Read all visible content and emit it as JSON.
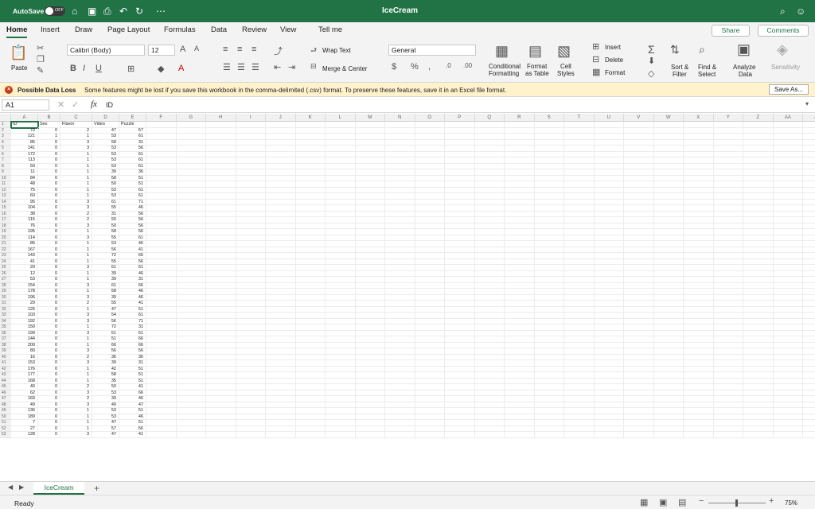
{
  "titlebar": {
    "autosave": "AutoSave",
    "autosave_state": "OFF",
    "doc_title": "IceCream",
    "accent": "#217346"
  },
  "tabs": [
    "Home",
    "Insert",
    "Draw",
    "Page Layout",
    "Formulas",
    "Data",
    "Review",
    "View",
    "Tell me"
  ],
  "share": "Share",
  "comments": "Comments",
  "ribbon": {
    "paste": "Paste",
    "font": "Calibri (Body)",
    "size": "12",
    "wrap": "Wrap Text",
    "merge": "Merge & Center",
    "numfmt": "General",
    "cond_format": [
      "Conditional",
      "Formatting"
    ],
    "format_table": [
      "Format",
      "as Table"
    ],
    "cell_styles": [
      "Cell",
      "Styles"
    ],
    "insert": "Insert",
    "delete": "Delete",
    "format": "Format",
    "sort": [
      "Sort &",
      "Filter"
    ],
    "find": [
      "Find &",
      "Select"
    ],
    "analyze": [
      "Analyze",
      "Data"
    ],
    "sensitivity": "Sensitivity"
  },
  "infobar": {
    "title": "Possible Data Loss",
    "message": "Some features might be lost if you save this workbook in the comma-delimited (.csv) format. To preserve these features, save it in an Excel file format.",
    "button": "Save As..."
  },
  "formula": {
    "name_box": "A1",
    "value": "ID"
  },
  "columns": [
    "A",
    "B",
    "C",
    "D",
    "E",
    "F",
    "G",
    "H",
    "I",
    "J",
    "K",
    "L",
    "M",
    "N",
    "O",
    "P",
    "Q",
    "R",
    "S",
    "T",
    "U",
    "V",
    "W",
    "X",
    "Y",
    "Z",
    "AA",
    "AB",
    "AC"
  ],
  "headers": [
    "ID",
    "Sex",
    "Flavor",
    "Video",
    "Puzzle"
  ],
  "rows": [
    [
      "70",
      "0",
      "2",
      "47",
      "57"
    ],
    [
      "121",
      "1",
      "1",
      "53",
      "61"
    ],
    [
      "86",
      "0",
      "3",
      "58",
      "31"
    ],
    [
      "141",
      "0",
      "3",
      "53",
      "56"
    ],
    [
      "172",
      "0",
      "1",
      "53",
      "61"
    ],
    [
      "113",
      "0",
      "1",
      "53",
      "61"
    ],
    [
      "50",
      "0",
      "1",
      "53",
      "61"
    ],
    [
      "11",
      "0",
      "1",
      "39",
      "36"
    ],
    [
      "84",
      "0",
      "1",
      "58",
      "51"
    ],
    [
      "48",
      "0",
      "1",
      "50",
      "51"
    ],
    [
      "75",
      "0",
      "1",
      "53",
      "61"
    ],
    [
      "60",
      "0",
      "1",
      "53",
      "61"
    ],
    [
      "95",
      "0",
      "3",
      "61",
      "71"
    ],
    [
      "104",
      "0",
      "3",
      "55",
      "46"
    ],
    [
      "38",
      "0",
      "2",
      "31",
      "56"
    ],
    [
      "115",
      "0",
      "2",
      "50",
      "56"
    ],
    [
      "76",
      "0",
      "3",
      "50",
      "56"
    ],
    [
      "195",
      "0",
      "1",
      "58",
      "56"
    ],
    [
      "114",
      "0",
      "3",
      "55",
      "61"
    ],
    [
      "85",
      "0",
      "1",
      "53",
      "46"
    ],
    [
      "167",
      "0",
      "1",
      "56",
      "41"
    ],
    [
      "143",
      "0",
      "1",
      "72",
      "66"
    ],
    [
      "41",
      "0",
      "1",
      "55",
      "56"
    ],
    [
      "20",
      "0",
      "3",
      "61",
      "61"
    ],
    [
      "12",
      "0",
      "1",
      "39",
      "46"
    ],
    [
      "53",
      "0",
      "1",
      "39",
      "31"
    ],
    [
      "154",
      "0",
      "3",
      "61",
      "66"
    ],
    [
      "178",
      "0",
      "1",
      "58",
      "46"
    ],
    [
      "196",
      "0",
      "3",
      "39",
      "46"
    ],
    [
      "29",
      "0",
      "2",
      "55",
      "41"
    ],
    [
      "126",
      "0",
      "1",
      "47",
      "51"
    ],
    [
      "103",
      "0",
      "3",
      "54",
      "61"
    ],
    [
      "192",
      "0",
      "3",
      "56",
      "71"
    ],
    [
      "150",
      "0",
      "1",
      "72",
      "31"
    ],
    [
      "199",
      "0",
      "3",
      "61",
      "61"
    ],
    [
      "144",
      "0",
      "1",
      "51",
      "66"
    ],
    [
      "200",
      "0",
      "1",
      "66",
      "66"
    ],
    [
      "80",
      "0",
      "3",
      "56",
      "56"
    ],
    [
      "16",
      "0",
      "2",
      "36",
      "36"
    ],
    [
      "153",
      "0",
      "3",
      "39",
      "31"
    ],
    [
      "176",
      "0",
      "1",
      "42",
      "51"
    ],
    [
      "177",
      "0",
      "1",
      "58",
      "51"
    ],
    [
      "168",
      "0",
      "1",
      "35",
      "51"
    ],
    [
      "40",
      "0",
      "2",
      "50",
      "41"
    ],
    [
      "62",
      "0",
      "3",
      "53",
      "66"
    ],
    [
      "169",
      "0",
      "2",
      "39",
      "46"
    ],
    [
      "49",
      "0",
      "3",
      "49",
      "47"
    ],
    [
      "136",
      "0",
      "1",
      "53",
      "51"
    ],
    [
      "189",
      "0",
      "1",
      "53",
      "46"
    ],
    [
      "7",
      "0",
      "1",
      "47",
      "51"
    ],
    [
      "27",
      "0",
      "1",
      "57",
      "56"
    ],
    [
      "128",
      "0",
      "3",
      "47",
      "41"
    ]
  ],
  "sheet": {
    "tab": "IceCream",
    "add": "+"
  },
  "status": {
    "ready": "Ready",
    "zoom": "75%"
  }
}
